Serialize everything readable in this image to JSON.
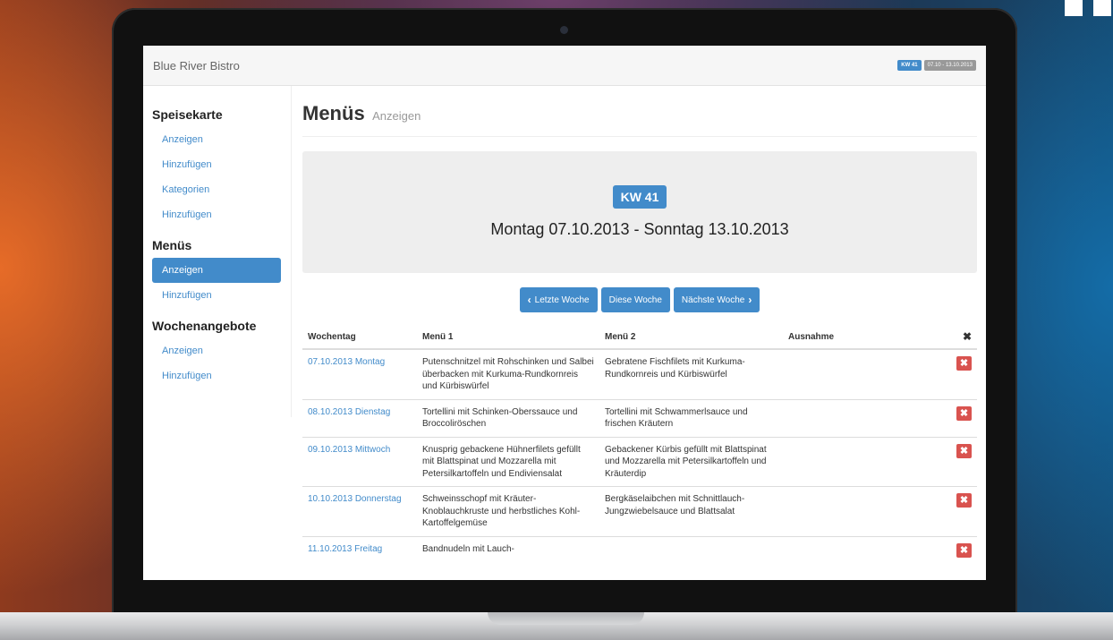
{
  "navbar": {
    "brand": "Blue River Bistro",
    "week_badge": "KW 41",
    "date_badge": "07.10 - 13.10.2013"
  },
  "sidebar": {
    "sections": [
      {
        "title": "Speisekarte",
        "items": [
          "Anzeigen",
          "Hinzufügen",
          "Kategorien",
          "Hinzufügen"
        ]
      },
      {
        "title": "Menüs",
        "items": [
          "Anzeigen",
          "Hinzufügen"
        ],
        "active_index": 0
      },
      {
        "title": "Wochenangebote",
        "items": [
          "Anzeigen",
          "Hinzufügen"
        ]
      }
    ]
  },
  "page": {
    "title": "Menüs",
    "subtitle": "Anzeigen"
  },
  "jumbotron": {
    "week_label": "KW 41",
    "range": "Montag 07.10.2013 - Sonntag 13.10.2013"
  },
  "buttons": {
    "prev": "Letzte Woche",
    "current": "Diese Woche",
    "next": "Nächste Woche"
  },
  "table": {
    "headers": [
      "Wochentag",
      "Menü 1",
      "Menü 2",
      "Ausnahme",
      "✖"
    ],
    "rows": [
      {
        "day": "07.10.2013 Montag",
        "menu1": "Putenschnitzel mit Rohschinken und Salbei überbacken mit Kurkuma-Rundkornreis und Kürbiswürfel",
        "menu2": "Gebratene Fischfilets mit Kurkuma-Rundkornreis und Kürbiswürfel",
        "exception": ""
      },
      {
        "day": "08.10.2013 Dienstag",
        "menu1": "Tortellini mit Schinken-Oberssauce und Broccoliröschen",
        "menu2": "Tortellini mit Schwammerlsauce und frischen Kräutern",
        "exception": ""
      },
      {
        "day": "09.10.2013 Mittwoch",
        "menu1": "Knusprig gebackene Hühnerfilets gefüllt mit Blattspinat und Mozzarella mit Petersilkartoffeln und Endiviensalat",
        "menu2": "Gebackener Kürbis gefüllt mit Blattspinat und Mozzarella mit Petersilkartoffeln und Kräuterdip",
        "exception": ""
      },
      {
        "day": "10.10.2013 Donnerstag",
        "menu1": "Schweinsschopf mit Kräuter-Knoblauchkruste und herbstliches Kohl-Kartoffelgemüse",
        "menu2": "Bergkäselaibchen mit Schnittlauch-Jungzwiebelsauce und Blattsalat",
        "exception": ""
      },
      {
        "day": "11.10.2013 Freitag",
        "menu1": "Bandnudeln mit Lauch-",
        "menu2": "",
        "exception": ""
      }
    ],
    "delete_icon": "✖"
  },
  "colors": {
    "primary": "#428bca",
    "danger": "#d9534f"
  }
}
